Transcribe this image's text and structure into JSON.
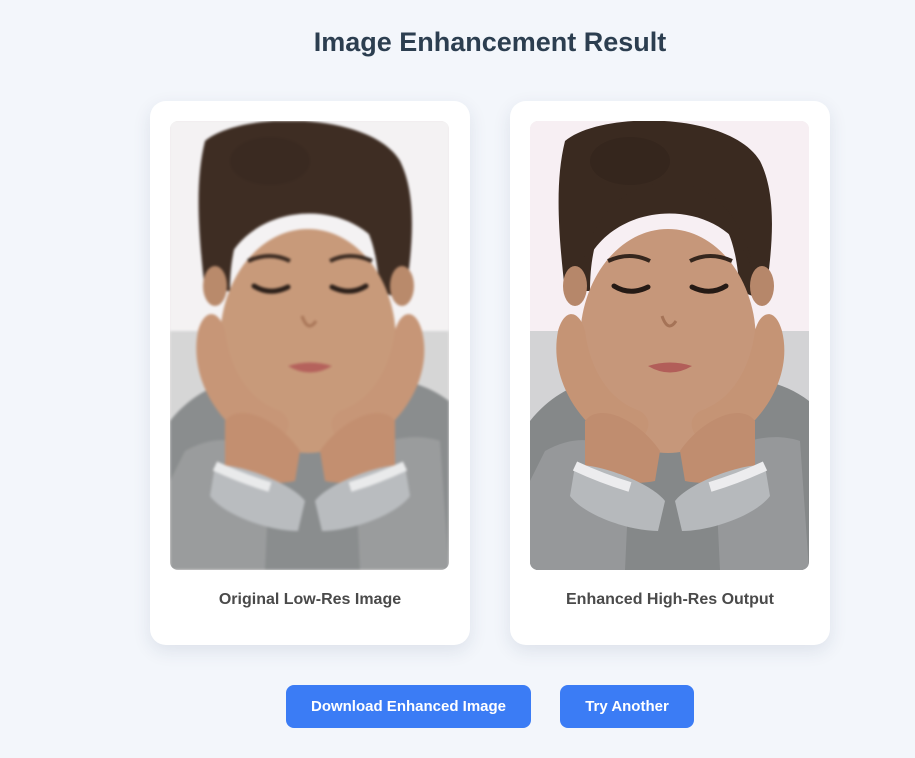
{
  "page": {
    "title": "Image Enhancement Result"
  },
  "cards": {
    "original": {
      "caption": "Original Low-Res Image",
      "image_alt": "Original Low-Res Image"
    },
    "enhanced": {
      "caption": "Enhanced High-Res Output",
      "image_alt": "Enhanced High-Res Output"
    }
  },
  "actions": {
    "download_label": "Download Enhanced Image",
    "try_another_label": "Try Another"
  },
  "colors": {
    "background": "#f3f6fb",
    "accent": "#3b7cf5",
    "title": "#2c3e50",
    "caption": "#4a4a4a"
  }
}
